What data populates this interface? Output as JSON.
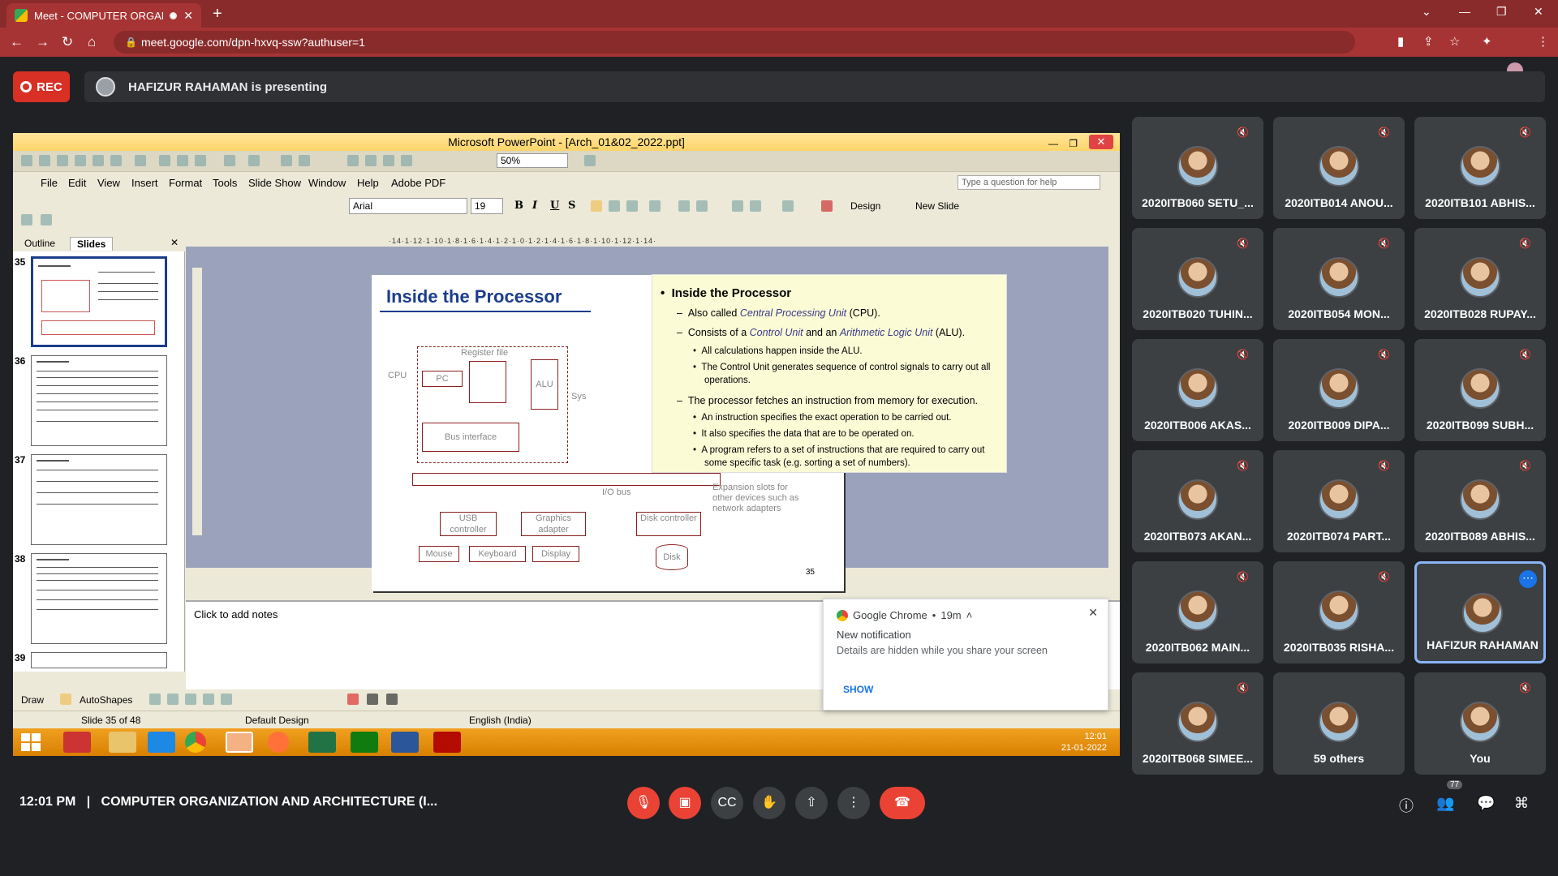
{
  "browser": {
    "tab_title": "Meet - COMPUTER ORGANIZ",
    "url": "meet.google.com/dpn-hxvq-ssw?authuser=1"
  },
  "meet": {
    "rec_label": "REC",
    "presenting_text": "HAFIZUR RAHAMAN is presenting",
    "time": "12:01 PM",
    "separator": "|",
    "meeting_title": "COMPUTER ORGANIZATION AND ARCHITECTURE (I...",
    "people_count": "77",
    "participants": [
      {
        "name": "2020ITB060 SETU_..."
      },
      {
        "name": "2020ITB014 ANOU..."
      },
      {
        "name": "2020ITB101 ABHIS..."
      },
      {
        "name": "2020ITB020 TUHIN..."
      },
      {
        "name": "2020ITB054 MON..."
      },
      {
        "name": "2020ITB028 RUPAY..."
      },
      {
        "name": "2020ITB006 AKAS..."
      },
      {
        "name": "2020ITB009 DIPA..."
      },
      {
        "name": "2020ITB099 SUBH..."
      },
      {
        "name": "2020ITB073 AKAN..."
      },
      {
        "name": "2020ITB074 PART..."
      },
      {
        "name": "2020ITB089 ABHIS..."
      },
      {
        "name": "2020ITB062 MAIN..."
      },
      {
        "name": "2020ITB035 RISHA..."
      },
      {
        "name": "HAFIZUR RAHAMAN"
      },
      {
        "name": "2020ITB068 SIMEE..."
      },
      {
        "name": "59 others"
      },
      {
        "name": "You"
      }
    ]
  },
  "powerpoint": {
    "window_title": "Microsoft PowerPoint - [Arch_01&02_2022.ppt]",
    "zoom": "50%",
    "menu": [
      "File",
      "Edit",
      "View",
      "Insert",
      "Format",
      "Tools",
      "Slide Show",
      "Window",
      "Help",
      "Adobe PDF"
    ],
    "help_placeholder": "Type a question for help",
    "font": "Arial",
    "font_size": "19",
    "design_label": "Design",
    "new_slide_label": "New Slide",
    "tab_outline": "Outline",
    "tab_slides": "Slides",
    "slide_numbers": [
      "35",
      "36",
      "37",
      "38",
      "39"
    ],
    "ruler": "·14·1·12·1·10·1·8·1·6·1·4·1·2·1·0·1·2·1·4·1·6·1·8·1·10·1·12·1·14·",
    "notes_placeholder": "Click to add notes",
    "draw_label": "Draw",
    "autoshapes_label": "AutoShapes",
    "status_slide": "Slide 35 of 48",
    "status_design": "Default Design",
    "status_lang": "English (India)",
    "clock_time": "12:01",
    "clock_date": "21-01-2022"
  },
  "slide": {
    "title": "Inside the Processor",
    "number": "35",
    "diagram": {
      "cpu": "CPU",
      "pc": "PC",
      "register_file": "Register file",
      "alu": "ALU",
      "bus_interface": "Bus interface",
      "io_bus": "I/O bus",
      "usb": "USB controller",
      "graphics": "Graphics adapter",
      "disk_ctrl": "Disk controller",
      "mouse": "Mouse",
      "keyboard": "Keyboard",
      "display": "Display",
      "disk": "Disk",
      "expansion": "Expansion slots for other devices such as network adapters",
      "sys": "Sys"
    },
    "bullets": {
      "heading": "Inside the Processor",
      "b1_pre": "Also called ",
      "b1_em": "Central Processing Unit",
      "b1_post": " (CPU).",
      "b2_pre": "Consists of a ",
      "b2_em1": "Control Unit",
      "b2_mid": " and an ",
      "b2_em2": "Arithmetic Logic Unit",
      "b2_post": " (ALU).",
      "b2a": "All calculations happen inside the ALU.",
      "b2b_1": "The Control Unit generates sequence of control signals to carry out all",
      "b2b_2": "operations.",
      "b3": "The processor fetches an instruction from memory for execution.",
      "b3a": "An instruction specifies the exact operation to be carried out.",
      "b3b": "It also specifies the data that are to be operated on.",
      "b3c_1": "A program refers to a set of instructions that are required to carry out",
      "b3c_2": "some specific task (e.g. sorting a set of numbers)."
    }
  },
  "notification": {
    "app": "Google Chrome",
    "time": "19m",
    "title": "New notification",
    "body": "Details are hidden while you share your screen",
    "action": "SHOW"
  }
}
